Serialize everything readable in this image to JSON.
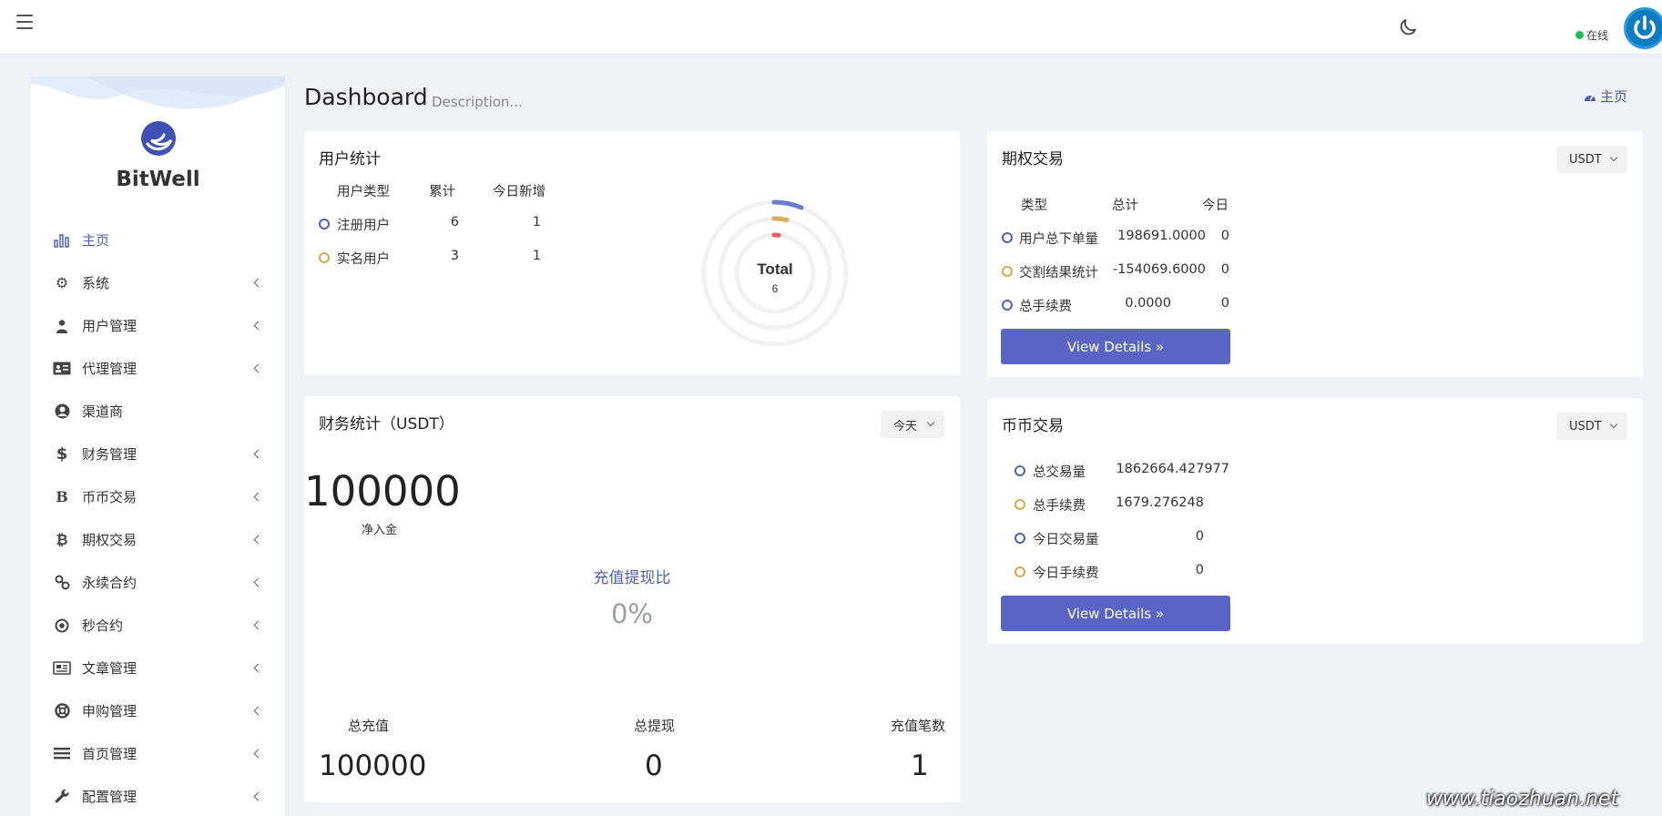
{
  "topbar": {
    "status_label": "在线"
  },
  "sidebar": {
    "brand": "BitWell",
    "items": [
      {
        "label": "主页",
        "icon": "bar-chart-icon",
        "active": true,
        "chevron": false
      },
      {
        "label": "系统",
        "icon": "gear-icon",
        "chevron": true
      },
      {
        "label": "用户管理",
        "icon": "user-tie-icon",
        "chevron": true
      },
      {
        "label": "代理管理",
        "icon": "id-card-icon",
        "chevron": true
      },
      {
        "label": "渠道商",
        "icon": "user-circle-icon",
        "chevron": false
      },
      {
        "label": "财务管理",
        "icon": "dollar-icon",
        "chevron": true
      },
      {
        "label": "币币交易",
        "icon": "bold-b-icon",
        "chevron": true
      },
      {
        "label": "期权交易",
        "icon": "bitcoin-icon",
        "chevron": true
      },
      {
        "label": "永续合约",
        "icon": "link-icon",
        "chevron": true
      },
      {
        "label": "秒合约",
        "icon": "dot-circle-icon",
        "chevron": true
      },
      {
        "label": "文章管理",
        "icon": "newspaper-icon",
        "chevron": true
      },
      {
        "label": "申购管理",
        "icon": "lifebuoy-icon",
        "chevron": true
      },
      {
        "label": "首页管理",
        "icon": "list-icon",
        "chevron": true
      },
      {
        "label": "配置管理",
        "icon": "wrench-icon",
        "chevron": true
      }
    ]
  },
  "header": {
    "title": "Dashboard",
    "description": "Description...",
    "breadcrumb": "主页"
  },
  "user_stats": {
    "title": "用户统计",
    "headers": [
      "用户类型",
      "累计",
      "今日新增"
    ],
    "rows": [
      {
        "label": "注册用户",
        "total": "6",
        "today": "1"
      },
      {
        "label": "实名用户",
        "total": "3",
        "today": "1"
      }
    ],
    "donut_label": "Total",
    "donut_value": "6"
  },
  "finance": {
    "title": "财务统计（USDT）",
    "period": "今天",
    "net_value": "100000",
    "net_label": "净入金",
    "ratio_label": "充值提现比",
    "ratio_value": "0%",
    "totals": [
      {
        "label": "总充值",
        "value": "100000"
      },
      {
        "label": "总提现",
        "value": "0"
      },
      {
        "label": "充值笔数",
        "value": "1"
      }
    ]
  },
  "options": {
    "title": "期权交易",
    "currency": "USDT",
    "headers": [
      "类型",
      "总计",
      "今日"
    ],
    "rows": [
      {
        "label": "用户总下单量",
        "total": "198691.0000",
        "today": "0"
      },
      {
        "label": "交割结果统计",
        "total": "-154069.6000",
        "today": "0"
      },
      {
        "label": "总手续费",
        "total": "0.0000",
        "today": "0"
      }
    ],
    "button": "View Details »"
  },
  "spot": {
    "title": "币币交易",
    "currency": "USDT",
    "rows": [
      {
        "label": "总交易量",
        "value": "1862664.427977"
      },
      {
        "label": "总手续费",
        "value": "1679.276248"
      },
      {
        "label": "今日交易量",
        "value": "0"
      },
      {
        "label": "今日手续费",
        "value": "0"
      }
    ],
    "button": "View Details »"
  },
  "watermark": "www.tiaozhuan.net",
  "colors": {
    "accent": "#5865c4",
    "brand_blue": "#5160b8",
    "gold": "#d4a84c",
    "online": "#1cbb5c"
  }
}
